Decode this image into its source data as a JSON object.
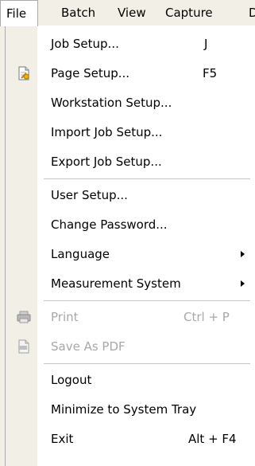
{
  "menubar": {
    "items": [
      {
        "label": "File"
      },
      {
        "label": "Batch"
      },
      {
        "label": "View"
      },
      {
        "label": "Capture"
      },
      {
        "label": "D"
      }
    ]
  },
  "menu": {
    "items": [
      {
        "label": "Job Setup...",
        "shortcut": "J"
      },
      {
        "label": "Page Setup...",
        "shortcut": "F5",
        "icon": "page-setup-icon"
      },
      {
        "label": "Workstation Setup..."
      },
      {
        "label": "Import Job Setup..."
      },
      {
        "label": "Export Job Setup..."
      },
      {
        "label": "User Setup..."
      },
      {
        "label": "Change Password..."
      },
      {
        "label": "Language",
        "submenu": true
      },
      {
        "label": "Measurement System",
        "submenu": true
      },
      {
        "label": "Print",
        "shortcut": "Ctrl + P",
        "disabled": true,
        "icon": "print-icon"
      },
      {
        "label": "Save As PDF",
        "disabled": true,
        "icon": "pdf-icon"
      },
      {
        "label": "Logout"
      },
      {
        "label": "Minimize to System Tray"
      },
      {
        "label": "Exit",
        "shortcut": "Alt + F4"
      }
    ]
  }
}
